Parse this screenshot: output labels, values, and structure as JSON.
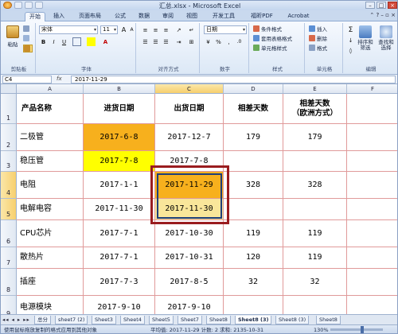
{
  "window": {
    "title": "汇总.xlsx - Microsoft Excel",
    "minimize": "–",
    "maximize": "□",
    "close": "×"
  },
  "ribbon_tabs": [
    "开始",
    "插入",
    "页面布局",
    "公式",
    "数据",
    "审阅",
    "视图",
    "开发工具",
    "福昕PDF",
    "Acrobat"
  ],
  "help": "⌃ ? – ▫ ×",
  "ribbon": {
    "clipboard": {
      "paste": "粘贴",
      "label": "剪贴板"
    },
    "font": {
      "name": "宋体",
      "size": "11",
      "bold": "B",
      "italic": "I",
      "underline": "U",
      "grow": "A",
      "shrink": "A",
      "label": "字体"
    },
    "alignment": {
      "label": "对齐方式"
    },
    "number": {
      "format": "日期",
      "percent": "%",
      "comma": ",",
      "label": "数字"
    },
    "styles": {
      "conditional": "条件格式",
      "table": "套用表格格式",
      "cell": "单元格样式",
      "label": "样式"
    },
    "cells": {
      "insert": "插入",
      "delete": "删除",
      "format": "格式",
      "label": "单元格"
    },
    "editing": {
      "sum": "Σ",
      "sort": "排序和筛选",
      "find": "查找和选择",
      "label": "编辑"
    }
  },
  "formula_bar": {
    "name_box": "C4",
    "fx": "fx",
    "value": "2017-11-29"
  },
  "columns": [
    "A",
    "B",
    "C",
    "D",
    "E",
    "F"
  ],
  "rows": [
    "1",
    "2",
    "3",
    "4",
    "5",
    "6",
    "7",
    "8",
    "9"
  ],
  "headers": {
    "name": "产品名称",
    "in_date": "进货日期",
    "out_date": "出货日期",
    "diff": "相差天数",
    "diff_eu_line1": "相差天数",
    "diff_eu_line2": "（欧洲方式）"
  },
  "table": [
    {
      "name": "二极管",
      "in": "2017-6-8",
      "out": "2017-12-7",
      "diff": "179",
      "eu": "179"
    },
    {
      "name": "稳压管",
      "in": "2017-7-8",
      "out": "2017-7-8",
      "diff": "",
      "eu": ""
    },
    {
      "name": "电阻",
      "in": "2017-1-1",
      "out": "2017-11-29",
      "diff": "328",
      "eu": "328"
    },
    {
      "name": "电解电容",
      "in": "2017-11-30",
      "out": "2017-11-30",
      "diff": "",
      "eu": ""
    },
    {
      "name": "CPU芯片",
      "in": "2017-7-1",
      "out": "2017-10-30",
      "diff": "119",
      "eu": "119"
    },
    {
      "name": "散热片",
      "in": "2017-7-1",
      "out": "2017-10-31",
      "diff": "120",
      "eu": "119"
    },
    {
      "name": "插座",
      "in": "2017-7-3",
      "out": "2017-8-5",
      "diff": "32",
      "eu": "32"
    },
    {
      "name": "电源模块",
      "in": "2017-9-10",
      "out": "2017-9-10",
      "diff": "",
      "eu": ""
    }
  ],
  "sheet_tabs": [
    "总分",
    "sheet7 (2)",
    "Sheet3",
    "Sheet4",
    "Sheet5",
    "Sheet7",
    "Sheet8",
    "Sheet8 (3)",
    "Sheet8 (3)",
    "Sheet8"
  ],
  "sheet_nav": "◂◂ ◂ ▸ ▸▸",
  "status": {
    "message": "使用鼠标拖放复制的格式应用到其他对象",
    "aggregates": "平均值: 2017-11-29   计数: 2   求和: 2135-10-31",
    "zoom": "130%"
  },
  "colors": {
    "orange": "#f7b01d",
    "yellow": "#ffff00",
    "selection": "#9a1c1f",
    "grid": "#e09a9a"
  }
}
